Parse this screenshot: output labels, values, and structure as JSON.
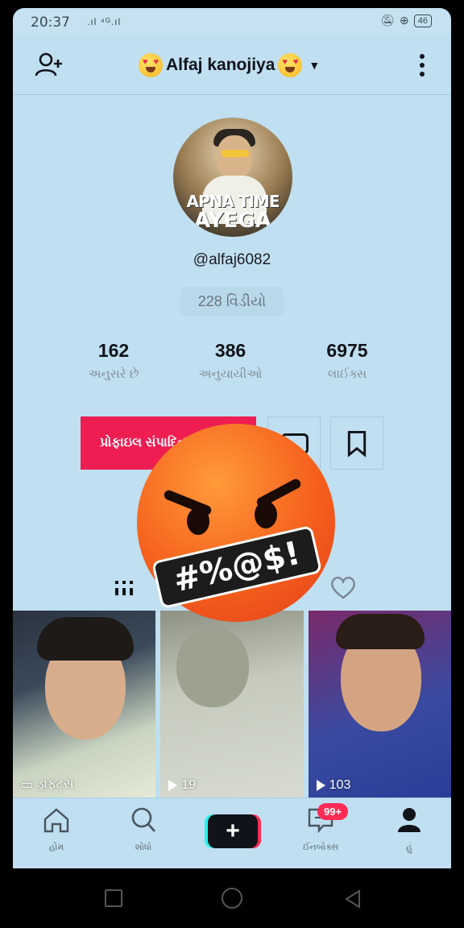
{
  "status": {
    "time": "20:37",
    "signal": ".ıl ⁴ᴳ.ıl",
    "battery": "46"
  },
  "header": {
    "title": "Alfaj kanojiya"
  },
  "profile": {
    "avatar_text_line1": "APNA TIME",
    "avatar_text_line2": "AYEGA",
    "handle": "@alfaj6082",
    "videos_count_label": "228 વિડીયો"
  },
  "stats": [
    {
      "value": "162",
      "label": "અનુસરે છે"
    },
    {
      "value": "386",
      "label": "અનુયાયીઓ"
    },
    {
      "value": "6975",
      "label": "લાઈક્સ"
    }
  ],
  "actions": {
    "edit_profile_label": "પ્રોફાઇલ સંપાદિત"
  },
  "sticker_text": "#%@$!",
  "videos": [
    {
      "caption": "ડ્રાફ્ટ્સ",
      "icon": "drafts-icon"
    },
    {
      "caption": "19",
      "icon": "play-icon"
    },
    {
      "caption": "103",
      "icon": "play-icon"
    }
  ],
  "bottom_nav": {
    "home": "હોમ",
    "search": "શોધો",
    "inbox": "ઈનબોક્સ",
    "inbox_badge": "99+",
    "me": "હું"
  },
  "colors": {
    "background": "#c0dff0",
    "accent": "#ee1d52",
    "badge": "#fe2c55"
  }
}
